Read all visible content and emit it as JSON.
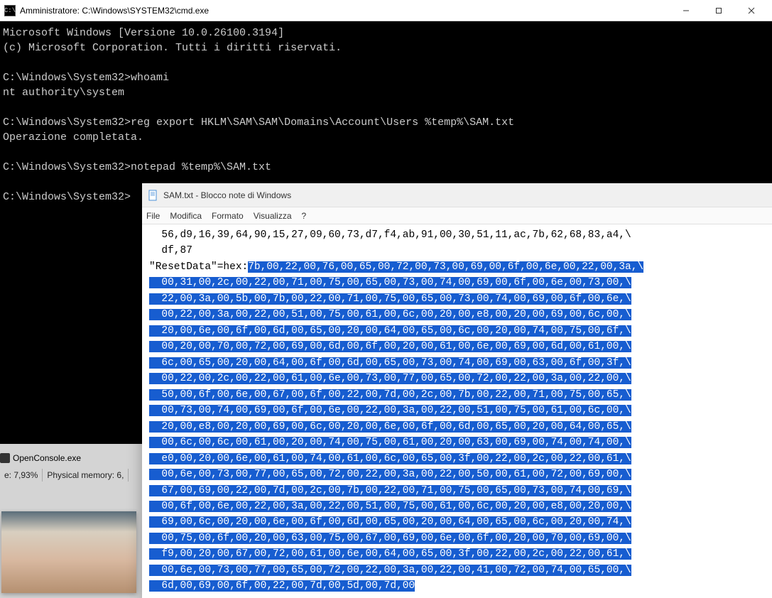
{
  "cmd": {
    "icon_text": "C:\\",
    "title": "Amministratore: C:\\Windows\\SYSTEM32\\cmd.exe",
    "body": "Microsoft Windows [Versione 10.0.26100.3194]\n(c) Microsoft Corporation. Tutti i diritti riservati.\n\nC:\\Windows\\System32>whoami\nnt authority\\system\n\nC:\\Windows\\System32>reg export HKLM\\SAM\\SAM\\Domains\\Account\\Users %temp%\\SAM.txt\nOperazione completata.\n\nC:\\Windows\\System32>notepad %temp%\\SAM.txt\n\nC:\\Windows\\System32>"
  },
  "proc": {
    "name": "OpenConsole.exe"
  },
  "stats": {
    "cpu": "e: 7,93%",
    "mem": "Physical memory: 6,"
  },
  "notepad": {
    "title": "SAM.txt - Blocco note di Windows",
    "menu": {
      "file": "File",
      "edit": "Modifica",
      "format": "Formato",
      "view": "Visualizza",
      "help": "?"
    },
    "pre_lines": [
      "  56,d9,16,39,64,90,15,27,09,60,73,d7,f4,ab,91,00,30,51,11,ac,7b,62,68,83,a4,\\",
      "  df,87"
    ],
    "reset_prefix": "\"ResetData\"=hex:",
    "reset_first": "7b,00,22,00,76,00,65,00,72,00,73,00,69,00,6f,00,6e,00,22,00,3a,\\",
    "reset_rest": [
      "  00,31,00,2c,00,22,00,71,00,75,00,65,00,73,00,74,00,69,00,6f,00,6e,00,73,00,\\",
      "  22,00,3a,00,5b,00,7b,00,22,00,71,00,75,00,65,00,73,00,74,00,69,00,6f,00,6e,\\",
      "  00,22,00,3a,00,22,00,51,00,75,00,61,00,6c,00,20,00,e8,00,20,00,69,00,6c,00,\\",
      "  20,00,6e,00,6f,00,6d,00,65,00,20,00,64,00,65,00,6c,00,20,00,74,00,75,00,6f,\\",
      "  00,20,00,70,00,72,00,69,00,6d,00,6f,00,20,00,61,00,6e,00,69,00,6d,00,61,00,\\",
      "  6c,00,65,00,20,00,64,00,6f,00,6d,00,65,00,73,00,74,00,69,00,63,00,6f,00,3f,\\",
      "  00,22,00,2c,00,22,00,61,00,6e,00,73,00,77,00,65,00,72,00,22,00,3a,00,22,00,\\",
      "  50,00,6f,00,6e,00,67,00,6f,00,22,00,7d,00,2c,00,7b,00,22,00,71,00,75,00,65,\\",
      "  00,73,00,74,00,69,00,6f,00,6e,00,22,00,3a,00,22,00,51,00,75,00,61,00,6c,00,\\",
      "  20,00,e8,00,20,00,69,00,6c,00,20,00,6e,00,6f,00,6d,00,65,00,20,00,64,00,65,\\",
      "  00,6c,00,6c,00,61,00,20,00,74,00,75,00,61,00,20,00,63,00,69,00,74,00,74,00,\\",
      "  e0,00,20,00,6e,00,61,00,74,00,61,00,6c,00,65,00,3f,00,22,00,2c,00,22,00,61,\\",
      "  00,6e,00,73,00,77,00,65,00,72,00,22,00,3a,00,22,00,50,00,61,00,72,00,69,00,\\",
      "  67,00,69,00,22,00,7d,00,2c,00,7b,00,22,00,71,00,75,00,65,00,73,00,74,00,69,\\",
      "  00,6f,00,6e,00,22,00,3a,00,22,00,51,00,75,00,61,00,6c,00,20,00,e8,00,20,00,\\",
      "  69,00,6c,00,20,00,6e,00,6f,00,6d,00,65,00,20,00,64,00,65,00,6c,00,20,00,74,\\",
      "  00,75,00,6f,00,20,00,63,00,75,00,67,00,69,00,6e,00,6f,00,20,00,70,00,69,00,\\",
      "  f9,00,20,00,67,00,72,00,61,00,6e,00,64,00,65,00,3f,00,22,00,2c,00,22,00,61,\\",
      "  00,6e,00,73,00,77,00,65,00,72,00,22,00,3a,00,22,00,41,00,72,00,74,00,65,00,\\",
      "  6d,00,69,00,6f,00,22,00,7d,00,5d,00,7d,00"
    ]
  }
}
